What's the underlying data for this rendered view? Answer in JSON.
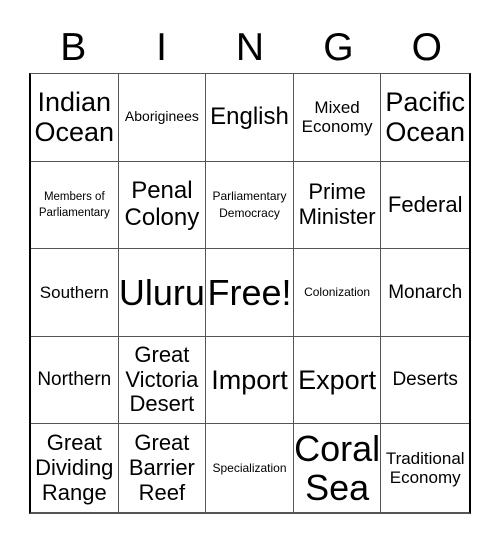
{
  "header": {
    "letters": [
      "B",
      "I",
      "N",
      "G",
      "O"
    ]
  },
  "cells": [
    [
      "Indian Ocean",
      "Aboriginees",
      "English",
      "Mixed Economy",
      "Pacific Ocean"
    ],
    [
      "Members of Parliamentary",
      "Penal Colony",
      "Parliamentary Democracy",
      "Prime Minister",
      "Federal"
    ],
    [
      "Southern",
      "Uluru",
      "Free!",
      "Colonization",
      "Monarch"
    ],
    [
      "Northern",
      "Great Victoria Desert",
      "Import",
      "Export",
      "Deserts"
    ],
    [
      "Great Dividing Range",
      "Great Barrier Reef",
      "Specialization",
      "Coral Sea",
      "Traditional Economy"
    ]
  ]
}
